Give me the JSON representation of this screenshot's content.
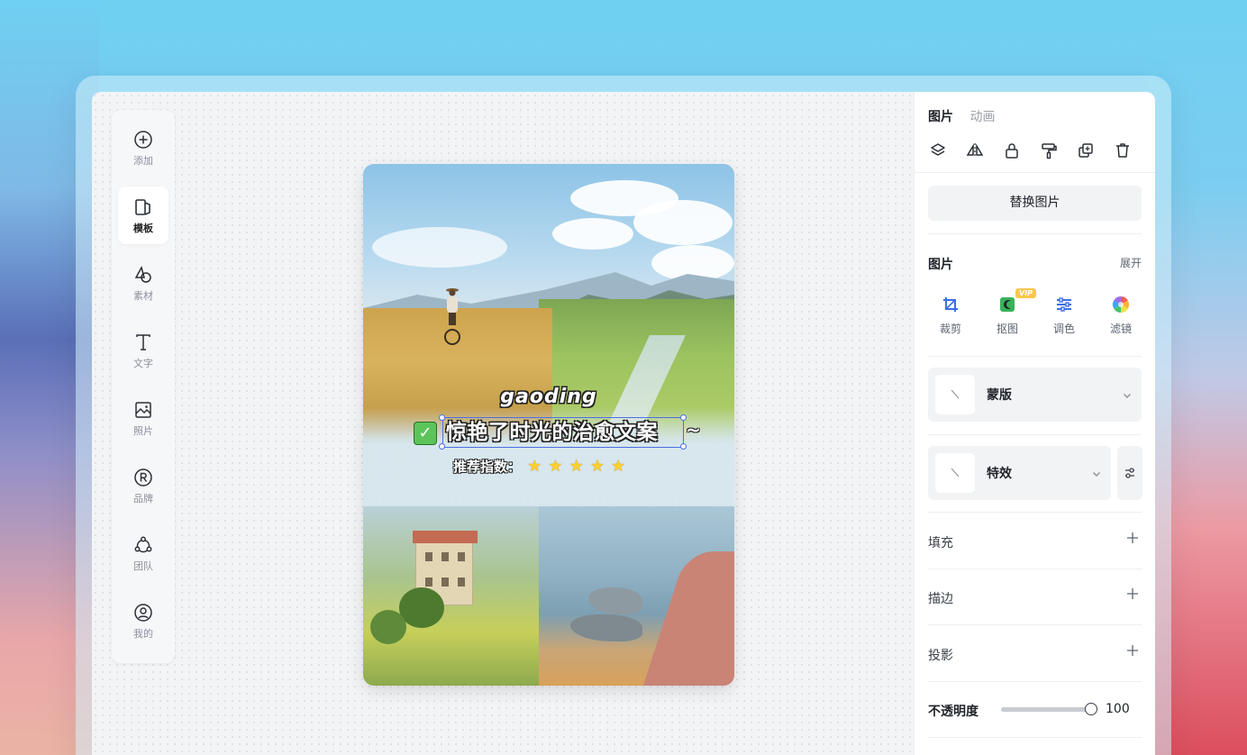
{
  "sidebar": {
    "items": [
      {
        "label": "添加",
        "icon": "plus-circle-icon"
      },
      {
        "label": "模板",
        "icon": "template-icon",
        "active": true
      },
      {
        "label": "素材",
        "icon": "shapes-icon"
      },
      {
        "label": "文字",
        "icon": "text-icon"
      },
      {
        "label": "照片",
        "icon": "image-icon"
      },
      {
        "label": "品牌",
        "icon": "brand-registered-icon"
      },
      {
        "label": "团队",
        "icon": "team-icon"
      },
      {
        "label": "我的",
        "icon": "user-circle-icon"
      }
    ]
  },
  "canvas": {
    "title_en": "gaoding",
    "title_zh": "惊艳了时光的治愈文案",
    "title_tail": "~",
    "rating_label": "推荐指数：",
    "rating_stars": 5,
    "check_mark": "✓"
  },
  "panel": {
    "tabs": [
      {
        "label": "图片",
        "active": true
      },
      {
        "label": "动画",
        "active": false
      }
    ],
    "action_icons": [
      "layers-icon",
      "flip-icon",
      "lock-icon",
      "format-painter-icon",
      "duplicate-icon",
      "delete-icon"
    ],
    "replace_button": "替换图片",
    "image_section": {
      "title": "图片",
      "expand_label": "展开",
      "tools": [
        {
          "label": "裁剪",
          "icon": "crop-icon"
        },
        {
          "label": "抠图",
          "icon": "cutout-icon",
          "badge": "VIP"
        },
        {
          "label": "调色",
          "icon": "adjust-color-icon"
        },
        {
          "label": "滤镜",
          "icon": "filter-icon"
        }
      ]
    },
    "mask_label": "蒙版",
    "effects_label": "特效",
    "fill_label": "填充",
    "stroke_label": "描边",
    "shadow_label": "投影",
    "opacity": {
      "label": "不透明度",
      "value": "100",
      "fraction": 1.0
    }
  },
  "colors": {
    "selection_blue": "#4a6fe3",
    "vip_badge": "#f7c84a",
    "star": "#ffcf2e"
  }
}
